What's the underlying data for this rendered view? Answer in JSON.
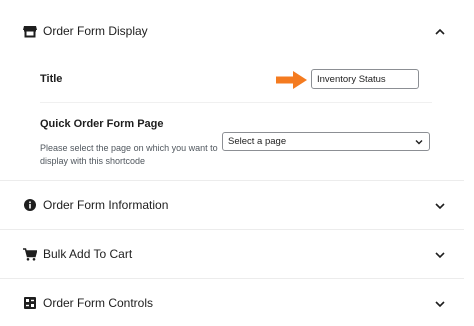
{
  "sections": [
    {
      "label": "Order Form Display",
      "icon": "storefront-icon",
      "expanded": true
    },
    {
      "label": "Order Form Information",
      "icon": "info-circle-icon",
      "expanded": false
    },
    {
      "label": "Bulk Add To Cart",
      "icon": "cart-icon",
      "expanded": false
    },
    {
      "label": "Order Form Controls",
      "icon": "controls-grid-icon",
      "expanded": false
    }
  ],
  "display": {
    "title_label": "Title",
    "title_value": "Inventory Status",
    "page_label": "Quick Order Form Page",
    "page_help": "Please select the page on which you want to display with this shortcode",
    "page_select_value": "Select a page"
  },
  "colors": {
    "arrow": "#f47b20",
    "text": "#1e1e1e",
    "border": "#8c8f94"
  }
}
